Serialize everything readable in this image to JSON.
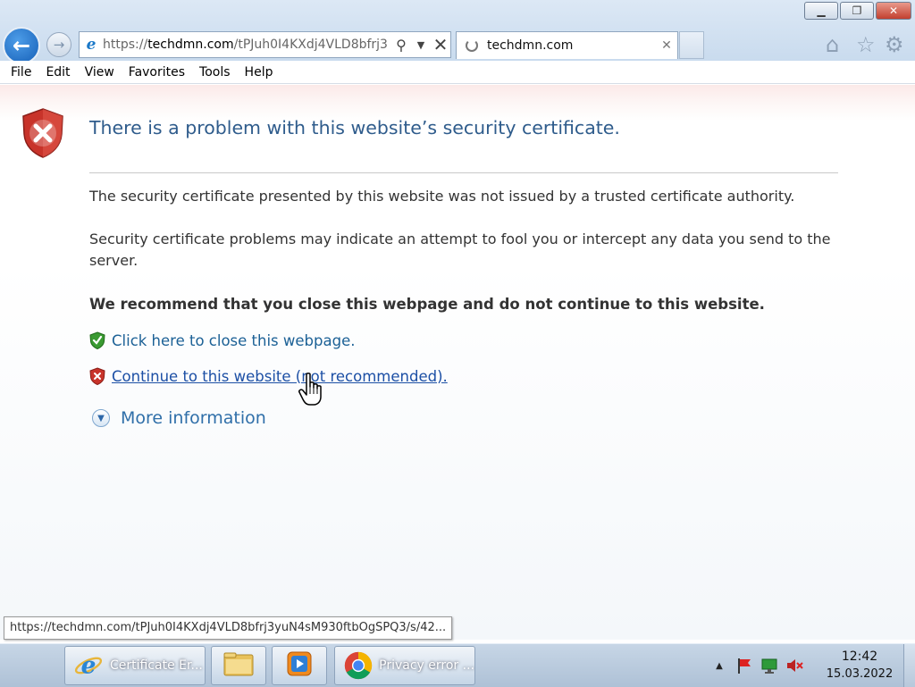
{
  "browser": {
    "address": {
      "prefix": "https://",
      "domain": "techdmn.com",
      "path": "/tPJuh0I4KXdj4VLD8bfrj3"
    },
    "tab": {
      "title": "techdmn.com"
    }
  },
  "menu": [
    "File",
    "Edit",
    "View",
    "Favorites",
    "Tools",
    "Help"
  ],
  "page": {
    "title": "There is a problem with this website’s security certificate.",
    "paragraph1": "The security certificate presented by this website was not issued by a trusted certificate authority.",
    "paragraph2": "Security certificate problems may indicate an attempt to fool you or intercept any data you send to the server.",
    "recommendation": "We recommend that you close this webpage and do not continue to this website.",
    "close_link": "Click here to close this webpage.",
    "continue_link": "Continue to this website (not recommended).",
    "more_info": "More information"
  },
  "status_url": "https://techdmn.com/tPJuh0I4KXdj4VLD8bfrj3yuN4sM930ftbOgSPQ3/s/42...",
  "taskbar": {
    "ie_task": "Certificate Er...",
    "chrome_task": "Privacy error ...",
    "clock_time": "12:42",
    "clock_date": "15.03.2022"
  },
  "colors": {
    "title_blue": "#2f5c8c",
    "link_blue": "#1c4fa5",
    "shield_red": "#c8332a",
    "shield_green": "#3a9a32"
  }
}
